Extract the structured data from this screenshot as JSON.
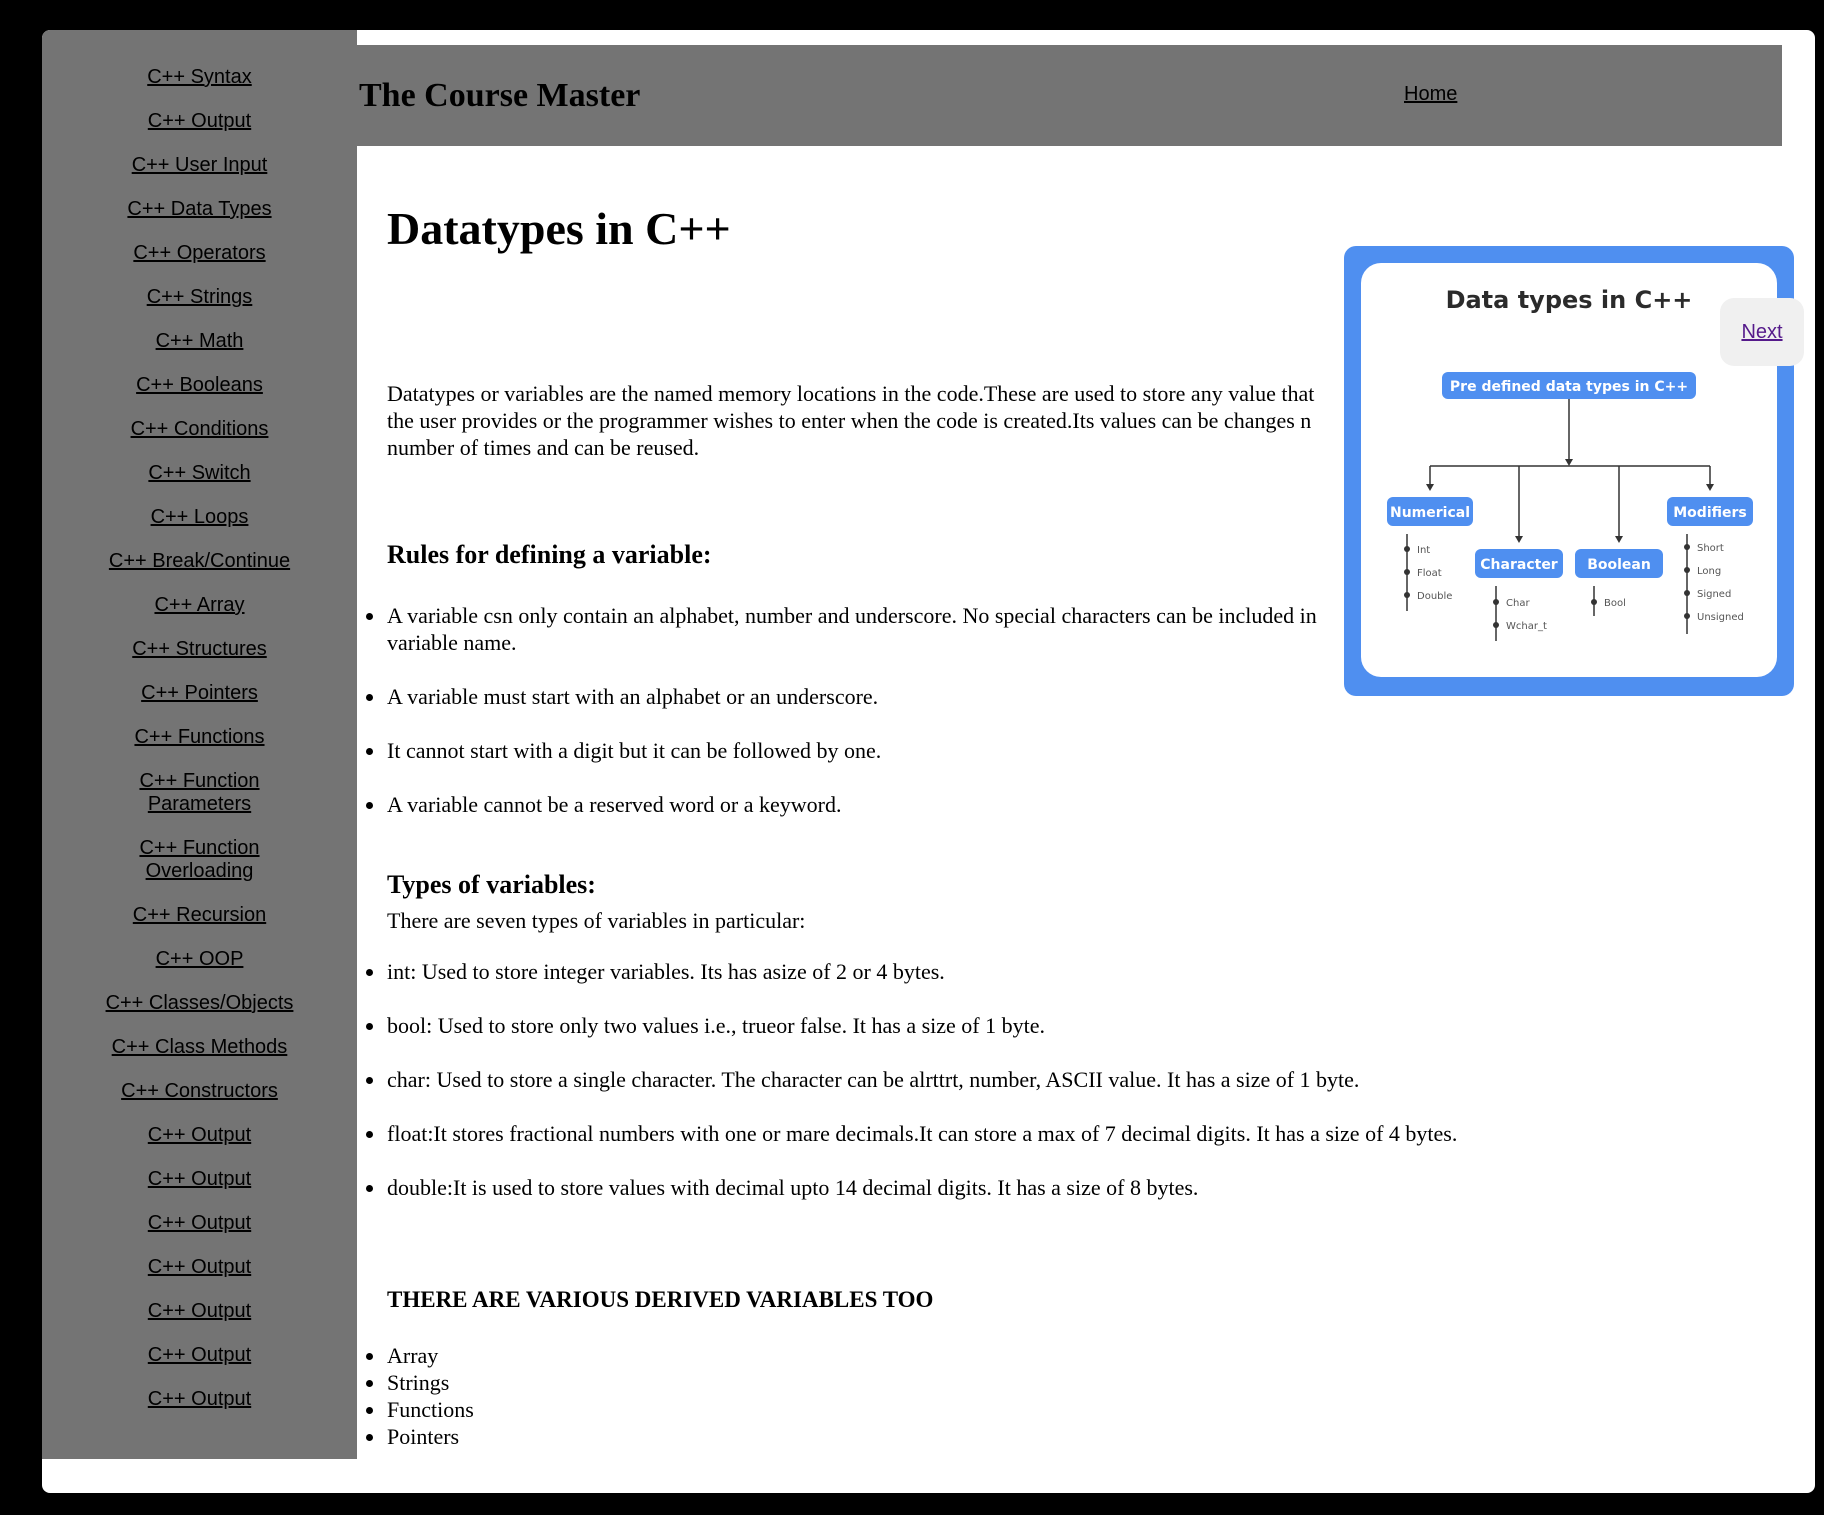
{
  "header": {
    "site_title": "The Course Master",
    "home_label": "Home"
  },
  "sidebar": {
    "items": [
      "C++ Syntax",
      "C++ Output",
      "C++ User Input",
      "C++ Data Types",
      "C++ Operators",
      "C++ Strings",
      "C++ Math",
      "C++ Booleans",
      "C++ Conditions",
      "C++ Switch",
      "C++ Loops",
      "C++ Break/Continue",
      "C++ Array",
      "C++ Structures",
      "C++ Pointers",
      "C++ Functions",
      "C++ Function Parameters",
      "C++ Function Overloading",
      "C++ Recursion",
      "C++ OOP",
      "C++ Classes/Objects",
      "C++ Class Methods",
      "C++ Constructors",
      "C++ Output",
      "C++ Output",
      "C++ Output",
      "C++ Output",
      "C++ Output",
      "C++ Output",
      "C++ Output"
    ]
  },
  "main": {
    "title": "Datatypes in C++",
    "intro": "Datatypes or variables are the named memory locations in the code.These are used to store any value that the user provides or the programmer wishes to enter when the code is created.Its values can be changes n number of times and can be reused.",
    "rules_heading": "Rules for defining a variable:",
    "rules": [
      "A variable csn only contain an alphabet, number and underscore. No special characters can be included in variable name.",
      "A variable must start with an alphabet or an underscore.",
      "It cannot start with a digit but it can be followed by one.",
      "A variable cannot be a reserved word or a keyword."
    ],
    "types_heading": "Types of variables:",
    "types_intro": "There are seven types of variables in particular:",
    "types": [
      "int: Used to store integer variables. Its has asize of 2 or 4 bytes.",
      "bool: Used to store only two values i.e., trueor false. It has a size of 1 byte.",
      "char: Used to store a single character. The character can be alrttrt, number, ASCII value. It has a size of 1 byte.",
      "float:It stores fractional numbers with one or mare decimals.It can store a max of 7 decimal digits. It has a size of 4 bytes.",
      "double:It is used to store values with decimal upto 14 decimal digits. It has a size of 8 bytes."
    ],
    "derived_heading": "THERE ARE VARIOUS DERIVED VARIABLES TOO",
    "derived": [
      "Array",
      "Strings",
      "Functions",
      "Pointers"
    ]
  },
  "diagram": {
    "title": "Data types in C++",
    "root": "Pre defined data types in C++",
    "categories": {
      "numerical": {
        "label": "Numerical",
        "items": [
          "Int",
          "Float",
          "Double"
        ]
      },
      "character": {
        "label": "Character",
        "items": [
          "Char",
          "Wchar_t"
        ]
      },
      "boolean": {
        "label": "Boolean",
        "items": [
          "Bool"
        ]
      },
      "modifiers": {
        "label": "Modifiers",
        "items": [
          "Short",
          "Long",
          "Signed",
          "Unsigned"
        ]
      }
    },
    "accent_color": "#4f8ff0"
  },
  "nav": {
    "next_label": "Next"
  }
}
